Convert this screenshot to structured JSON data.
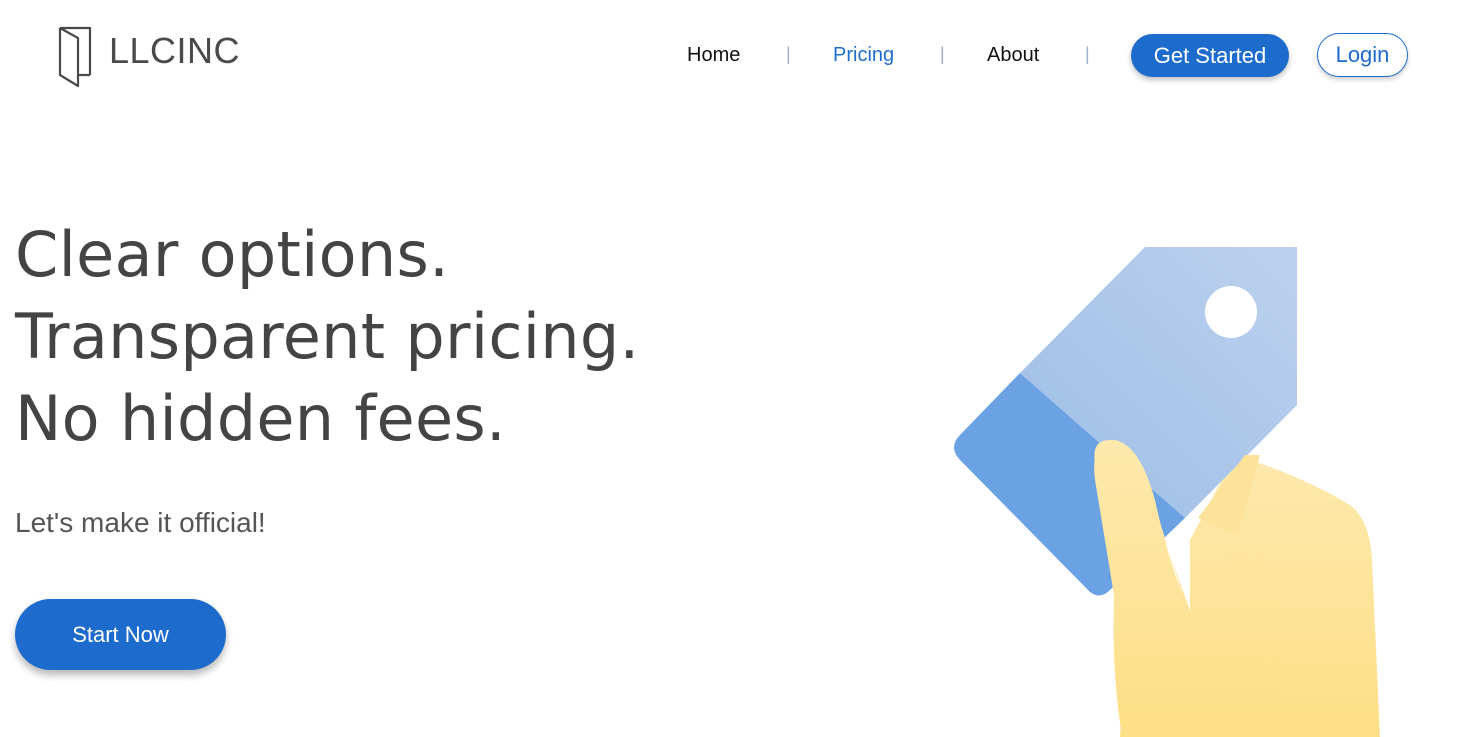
{
  "brand": {
    "name": "LLCINC",
    "icon": "door-logo-icon"
  },
  "nav": {
    "items": [
      {
        "label": "Home",
        "active": false
      },
      {
        "label": "Pricing",
        "active": true
      },
      {
        "label": "About",
        "active": false
      }
    ],
    "separator": "|",
    "get_started_label": "Get Started",
    "login_label": "Login"
  },
  "hero": {
    "lines": [
      "Clear options.",
      "Transparent pricing.",
      "No hidden fees."
    ],
    "subtitle": "Let's make it official!",
    "cta_label": "Start Now",
    "illustration": "hand-holding-price-tag-illustration"
  },
  "colors": {
    "primary": "#1d6ccd",
    "heading": "#444444",
    "tag_light": "#a9c6ea",
    "tag_dark": "#6aa2e4",
    "hand": "#fde39a"
  }
}
